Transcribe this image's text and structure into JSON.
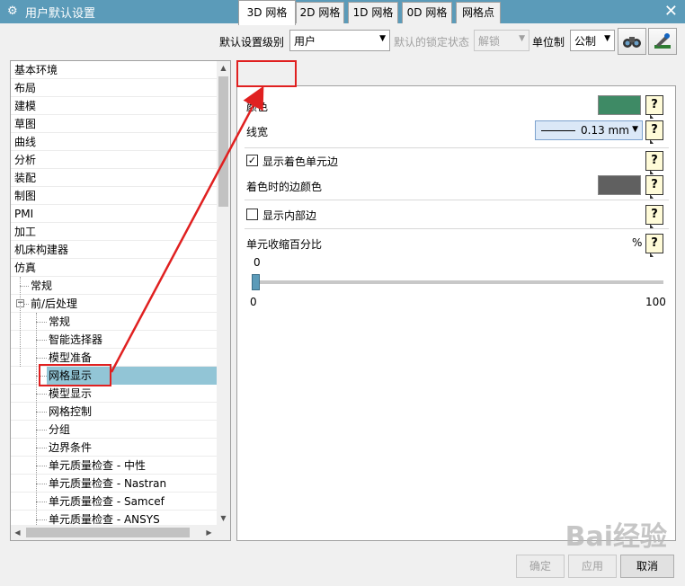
{
  "window": {
    "title": "用户默认设置"
  },
  "toolbar": {
    "level_label": "默认设置级别",
    "level_value": "用户",
    "lock_label": "默认的锁定状态",
    "lock_value": "解锁",
    "unit_label": "单位制",
    "unit_value": "公制"
  },
  "tree": {
    "items": [
      {
        "label": "基本环境",
        "depth": 0
      },
      {
        "label": "布局",
        "depth": 0
      },
      {
        "label": "建模",
        "depth": 0
      },
      {
        "label": "草图",
        "depth": 0
      },
      {
        "label": "曲线",
        "depth": 0
      },
      {
        "label": "分析",
        "depth": 0
      },
      {
        "label": "装配",
        "depth": 0
      },
      {
        "label": "制图",
        "depth": 0
      },
      {
        "label": "PMI",
        "depth": 0
      },
      {
        "label": "加工",
        "depth": 0
      },
      {
        "label": "机床构建器",
        "depth": 0
      },
      {
        "label": "仿真",
        "depth": 0
      },
      {
        "label": "常规",
        "depth": 1
      },
      {
        "label": "前/后处理",
        "depth": 1
      },
      {
        "label": "常规",
        "depth": 2
      },
      {
        "label": "智能选择器",
        "depth": 2
      },
      {
        "label": "模型准备",
        "depth": 2
      },
      {
        "label": "网格显示",
        "depth": 2
      },
      {
        "label": "模型显示",
        "depth": 2
      },
      {
        "label": "网格控制",
        "depth": 2
      },
      {
        "label": "分组",
        "depth": 2
      },
      {
        "label": "边界条件",
        "depth": 2
      },
      {
        "label": "单元质量检查 - 中性",
        "depth": 2
      },
      {
        "label": "单元质量检查 - Nastran",
        "depth": 2
      },
      {
        "label": "单元质量检查 - Samcef",
        "depth": 2
      },
      {
        "label": "单元质量检查 - ANSYS",
        "depth": 2
      }
    ],
    "expander_symbol": "−"
  },
  "tabs": [
    {
      "label": "3D 网格"
    },
    {
      "label": "2D 网格"
    },
    {
      "label": "1D 网格"
    },
    {
      "label": "0D 网格"
    },
    {
      "label": "网格点"
    }
  ],
  "panel": {
    "color_label": "颜色",
    "color_value": "#3e8a65",
    "linewidth_label": "线宽",
    "linewidth_value": "0.13 mm",
    "show_shaded_edges_label": "显示着色单元边",
    "show_shaded_edges_checked": true,
    "shaded_edge_color_label": "着色时的边颜色",
    "shaded_edge_color_value": "#606060",
    "show_interior_edges_label": "显示内部边",
    "show_interior_edges_checked": false,
    "shrink_label": "单元收缩百分比",
    "shrink_unit": "%",
    "shrink_value": "0",
    "slider_min": "0",
    "slider_max": "100",
    "help_symbol": "?",
    "check_symbol": "✓"
  },
  "buttons": {
    "ok": "确定",
    "apply": "应用",
    "cancel": "取消"
  },
  "watermark": "Bai经验"
}
